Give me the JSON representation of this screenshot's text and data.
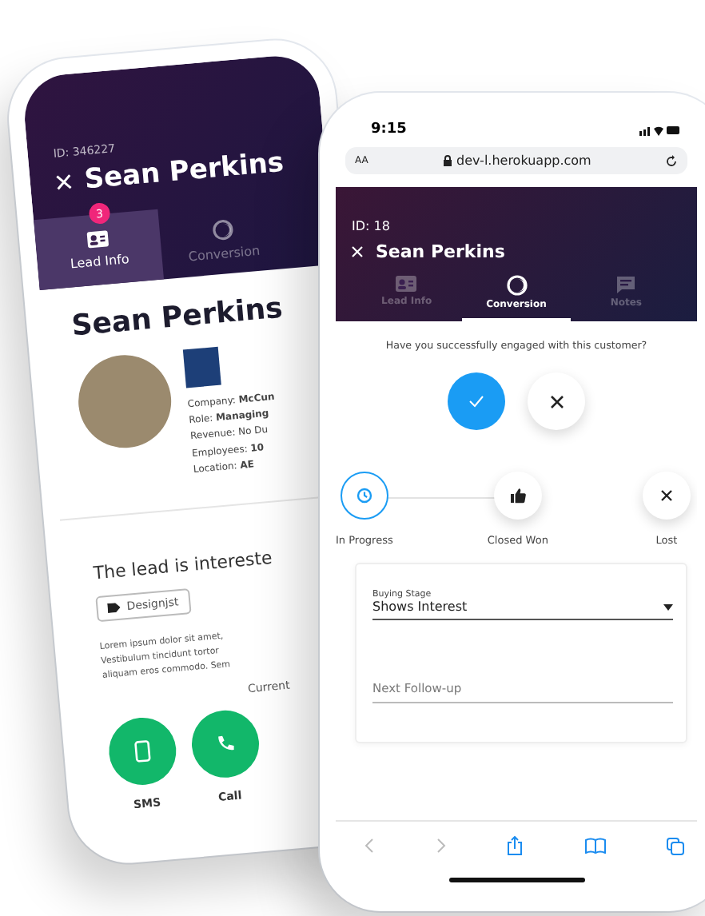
{
  "back_phone": {
    "lead_id": "ID: 346227",
    "title": "Sean Perkins",
    "tabs": [
      {
        "label": "Lead Info",
        "kind": "lead",
        "badge": "3",
        "selected": true
      },
      {
        "label": "Conversion",
        "kind": "conversion",
        "selected": false
      }
    ],
    "name": "Sean Perkins",
    "details": [
      "Company: **McCun**",
      "Role: **Managing**",
      "Revenue: No Du",
      "Employees: **10**",
      "Location: **AE**"
    ],
    "interest_text": "The lead is intereste",
    "tag": "Designjst",
    "notes": [
      "Lorem ipsum dolor sit amet,",
      "Vestibulum tincidunt tortor",
      "aliquam eros commodo. Sem"
    ],
    "current_label": "Current",
    "actions": [
      {
        "label": "SMS",
        "kind": "sms"
      },
      {
        "label": "Call",
        "kind": "call"
      }
    ]
  },
  "front_phone": {
    "status_bar": {
      "time": "9:15"
    },
    "browser": {
      "text_size": "AA",
      "url": "dev-l.herokuapp.com"
    },
    "header": {
      "lead_id": "ID: 18",
      "title": "Sean Perkins"
    },
    "tabs": [
      {
        "label": "Lead Info",
        "kind": "lead",
        "selected": false
      },
      {
        "label": "Conversion",
        "kind": "conversion",
        "selected": true
      },
      {
        "label": "Notes",
        "kind": "notes",
        "selected": false
      }
    ],
    "question": "Have you successfully engaged with this customer?",
    "engagement_options": [
      {
        "kind": "yes",
        "selected": true
      },
      {
        "kind": "no",
        "selected": false
      }
    ],
    "stages": [
      {
        "label": "In Progress",
        "kind": "progress",
        "selected": true
      },
      {
        "label": "Closed Won",
        "kind": "won",
        "selected": false
      },
      {
        "label": "Lost",
        "kind": "lost",
        "selected": false
      }
    ],
    "buying_stage": {
      "label": "Buying Stage",
      "value": "Shows Interest"
    },
    "next_follow_up": {
      "placeholder": "Next Follow-up"
    }
  }
}
